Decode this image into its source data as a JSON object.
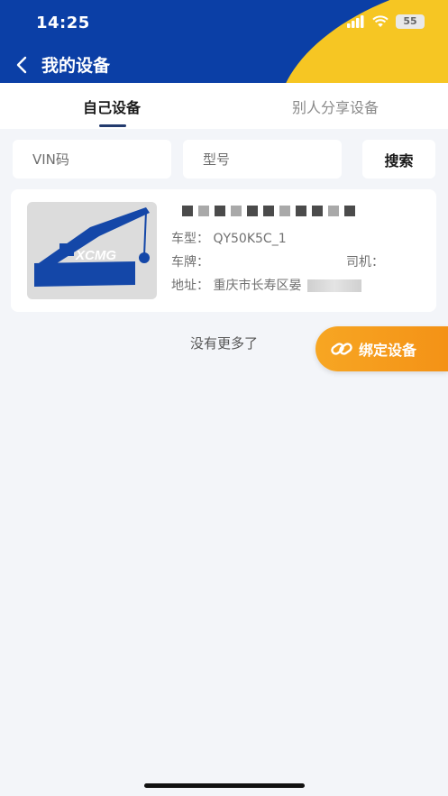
{
  "status": {
    "time": "14:25",
    "battery": "55"
  },
  "nav": {
    "title": "我的设备"
  },
  "tabs": [
    {
      "label": "自己设备",
      "active": true
    },
    {
      "label": "别人分享设备",
      "active": false
    }
  ],
  "search": {
    "vin_placeholder": "VIN码",
    "model_placeholder": "型号",
    "button_label": "搜索"
  },
  "device": {
    "logo_text": "XCMG",
    "model_label": "车型：",
    "model_value": "QY50K5C_1",
    "plate_label": "车牌：",
    "plate_value": "",
    "driver_label": "司机：",
    "driver_value": "",
    "address_label": "地址：",
    "address_value": "重庆市长寿区晏"
  },
  "list_end": "没有更多了",
  "bind_button": {
    "label": "绑定设备"
  },
  "colors": {
    "header_blue": "#0b3fa6",
    "accent_yellow": "#f6c623",
    "bind_orange": "#f49216",
    "xcmg_blue": "#1447a8"
  }
}
